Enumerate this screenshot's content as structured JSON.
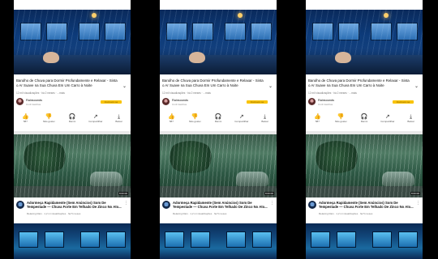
{
  "panels": [
    {
      "video": {
        "title": "Barulho de Chuva para Dormir Profundamente e Relaxar - Sinta o Ar Suave na Sua Chuva Em Um Carro à Noite",
        "meta": "12 mil visualizações · há 2 meses · ...mais",
        "channel_name": "Rainsounds",
        "channel_sub": "3 mil inscritos",
        "subscribe_label": "Inscrever-se"
      },
      "actions": [
        {
          "icon": "👍",
          "label": "587"
        },
        {
          "icon": "👎",
          "label": "Não gostei"
        },
        {
          "icon": "🎧",
          "label": "Remix"
        },
        {
          "icon": "↗",
          "label": "Compartilhar"
        },
        {
          "icon": "⤓",
          "label": "Baixar"
        }
      ],
      "next_video": {
        "duration": "8:00:00",
        "title": "Adormeça Rapidamente (Sem Anúncios) Som De Tempestade — Chuva Forte Em Telhado De Zinco No Ato...",
        "meta": "Relaxing Rain · 1,2 mi visualizações · há 5 meses"
      }
    },
    {
      "video": {
        "title": "Barulho de Chuva para Dormir Profundamente e Relaxar - Sinta o Ar Suave na Sua Chuva Em Um Carro à Noite",
        "meta": "12 mil visualizações · há 2 meses · ...mais",
        "channel_name": "Rainsounds",
        "channel_sub": "3 mil inscritos",
        "subscribe_label": "Inscrever-se"
      },
      "actions": [
        {
          "icon": "👍",
          "label": "587"
        },
        {
          "icon": "👎",
          "label": "Não gostei"
        },
        {
          "icon": "🎧",
          "label": "Remix"
        },
        {
          "icon": "↗",
          "label": "Compartilhar"
        },
        {
          "icon": "⤓",
          "label": "Baixar"
        }
      ],
      "next_video": {
        "duration": "8:00:00",
        "title": "Adormeça Rapidamente (Sem Anúncios) Som De Tempestade — Chuva Forte Em Telhado De Zinco No Ato...",
        "meta": "Relaxing Rain · 1,2 mi visualizações · há 5 meses"
      }
    },
    {
      "video": {
        "title": "Barulho de Chuva para Dormir Profundamente e Relaxar - Sinta o Ar Suave na Sua Chuva Em Um Carro à Noite",
        "meta": "12 mil visualizações · há 2 meses · ...mais",
        "channel_name": "Rainsounds",
        "channel_sub": "3 mil inscritos",
        "subscribe_label": "Inscrever-se"
      },
      "actions": [
        {
          "icon": "👍",
          "label": "587"
        },
        {
          "icon": "👎",
          "label": "Não gostei"
        },
        {
          "icon": "🎧",
          "label": "Remix"
        },
        {
          "icon": "↗",
          "label": "Compartilhar"
        },
        {
          "icon": "⤓",
          "label": "Baixar"
        }
      ],
      "next_video": {
        "duration": "8:00:00",
        "title": "Adormeça Rapidamente (Sem Anúncios) Som De Tempestade — Chuva Forte Em Telhado De Zinco No Ato...",
        "meta": "Relaxing Rain · 1,2 mi visualizações · há 5 meses"
      }
    }
  ],
  "colors": {
    "subscribe": "#f9c300",
    "background": "#000000",
    "panel": "#ffffff"
  }
}
